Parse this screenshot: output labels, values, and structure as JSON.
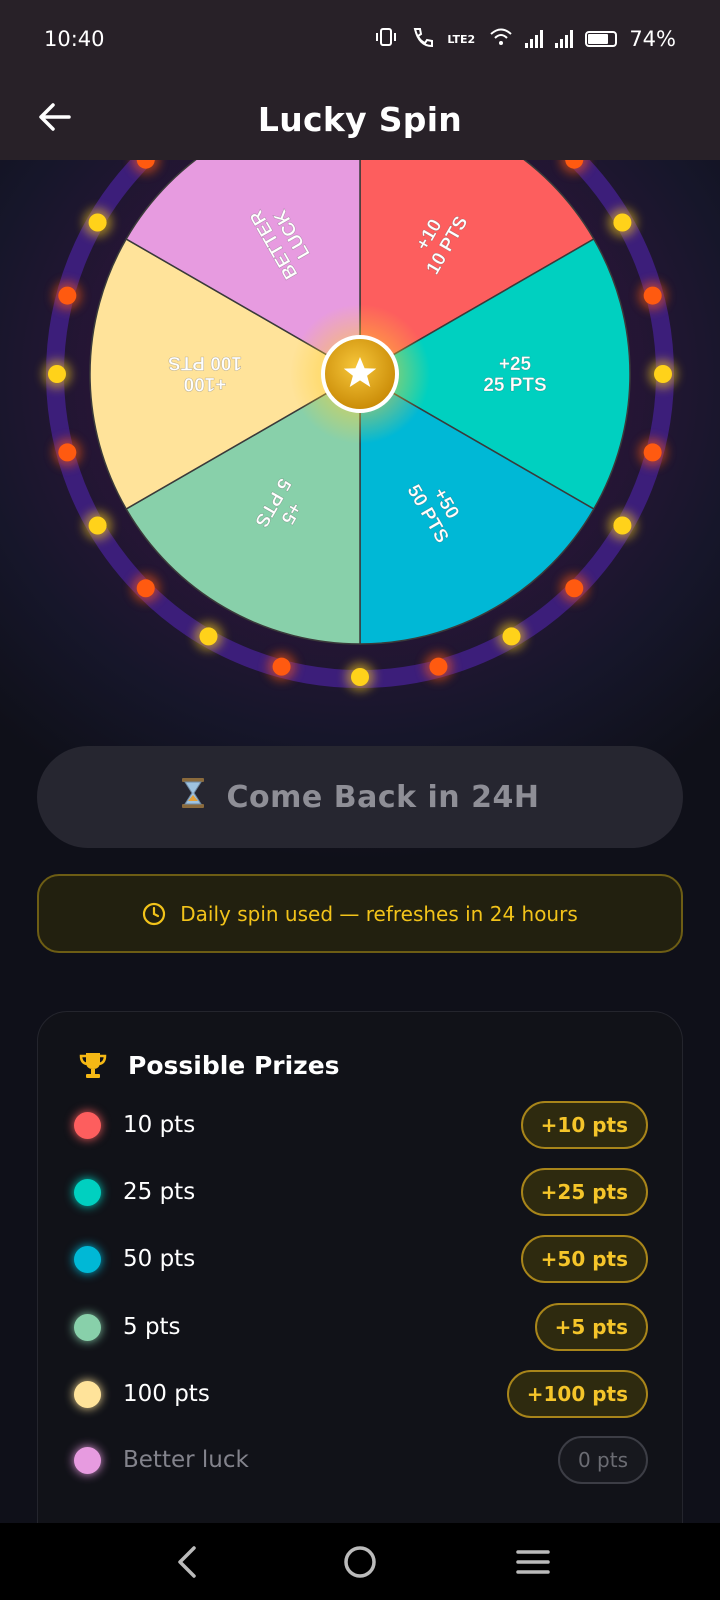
{
  "status": {
    "time": "10:40",
    "battery": "74%",
    "network": "LTE2"
  },
  "app": {
    "title": "Lucky Spin",
    "back_icon": "arrow-left-icon"
  },
  "wheel": {
    "segments": [
      {
        "line1": "+10",
        "line2": "10 PTS",
        "color": "#fd5e5e"
      },
      {
        "line1": "+25",
        "line2": "25 PTS",
        "color": "#00d0c0"
      },
      {
        "line1": "+50",
        "line2": "50 PTS",
        "color": "#00b8d6"
      },
      {
        "line1": "+5",
        "line2": "5 PTS",
        "color": "#88d0aa"
      },
      {
        "line1": "+100",
        "line2": "100 PTS",
        "color": "#ffe39a"
      },
      {
        "line1": "BETTER",
        "line2": "LUCK",
        "color": "#e79be0"
      }
    ],
    "center_icon": "star-icon",
    "rim_color": "#3c1e7a",
    "light_colors": [
      "#ffd21a",
      "#ff5a10"
    ]
  },
  "spin_button": {
    "label": "Come Back in 24H",
    "icon": "hourglass-icon"
  },
  "notice": {
    "text": "Daily spin used — refreshes in 24 hours",
    "icon": "clock-icon"
  },
  "prizes": {
    "title": "Possible Prizes",
    "icon": "trophy-icon",
    "items": [
      {
        "label": "10 pts",
        "badge": "+10 pts",
        "color": "#fd5e5e"
      },
      {
        "label": "25 pts",
        "badge": "+25 pts",
        "color": "#00d0c0"
      },
      {
        "label": "50 pts",
        "badge": "+50 pts",
        "color": "#00b8d6"
      },
      {
        "label": "5 pts",
        "badge": "+5 pts",
        "color": "#88d0aa"
      },
      {
        "label": "100 pts",
        "badge": "+100 pts",
        "color": "#ffe39a"
      },
      {
        "label": "Better luck",
        "badge": "0 pts",
        "color": "#e79be0"
      }
    ]
  },
  "nav": {
    "back": "back-icon",
    "home": "home-icon",
    "menu": "menu-icon"
  }
}
